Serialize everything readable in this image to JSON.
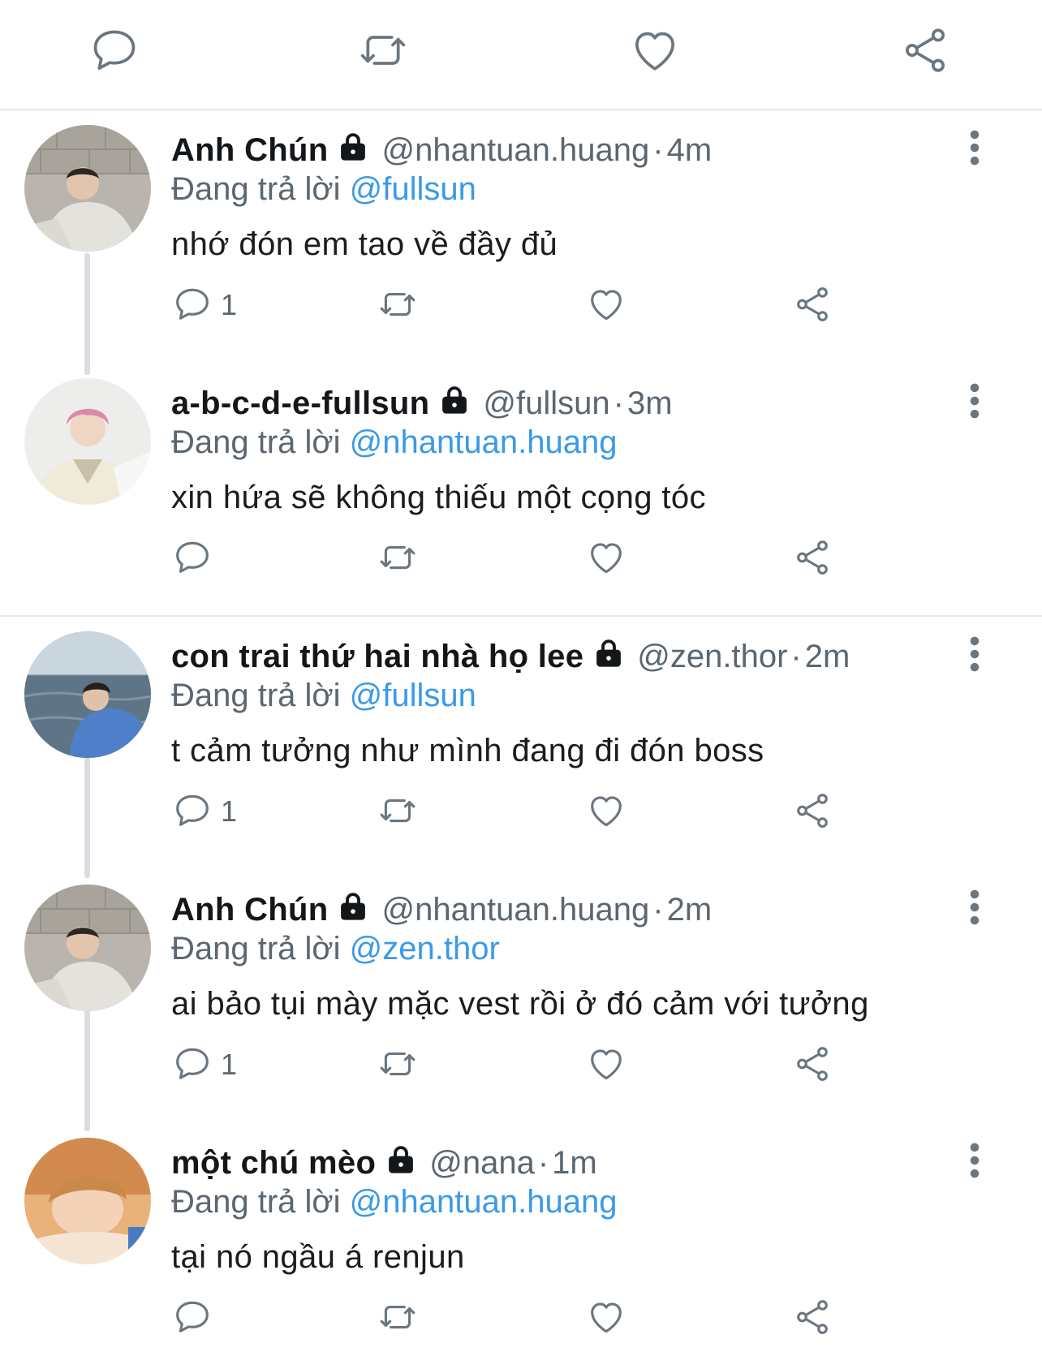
{
  "top_actions": {
    "reply_icon": "reply-icon",
    "retweet_icon": "retweet-icon",
    "like_icon": "heart-icon",
    "share_icon": "share-icon"
  },
  "reply_prefix": "Đang trả lời",
  "tweets": [
    {
      "name": "Anh Chún",
      "handle": "@nhantuan.huang",
      "separator": "·",
      "time": "4m",
      "reply_to": "@fullsun",
      "text": "nhớ đón em tao về đầy đủ",
      "reply_count": "1"
    },
    {
      "name": "a-b-c-d-e-fullsun",
      "handle": "@fullsun",
      "separator": "·",
      "time": "3m",
      "reply_to": "@nhantuan.huang",
      "text": "xin hứa sẽ không thiếu một cọng tóc",
      "reply_count": ""
    },
    {
      "name": "con trai thứ hai nhà họ lee",
      "handle": "@zen.thor",
      "separator": "·",
      "time": "2m",
      "reply_to": "@fullsun",
      "text": "t cảm tưởng như mình đang đi đón boss",
      "reply_count": "1"
    },
    {
      "name": "Anh Chún",
      "handle": "@nhantuan.huang",
      "separator": "·",
      "time": "2m",
      "reply_to": "@zen.thor",
      "text": "ai bảo tụi mày mặc vest rồi ở đó cảm với tưởng",
      "reply_count": "1"
    },
    {
      "name": "một chú mèo",
      "handle": "@nana",
      "separator": "·",
      "time": "1m",
      "reply_to": "@nhantuan.huang",
      "text": "tại nó ngầu á renjun",
      "reply_count": ""
    }
  ],
  "colors": {
    "link": "#3a9ae8",
    "muted": "#5b6670",
    "icon": "#6b7680",
    "divider": "#e6e8ea"
  }
}
